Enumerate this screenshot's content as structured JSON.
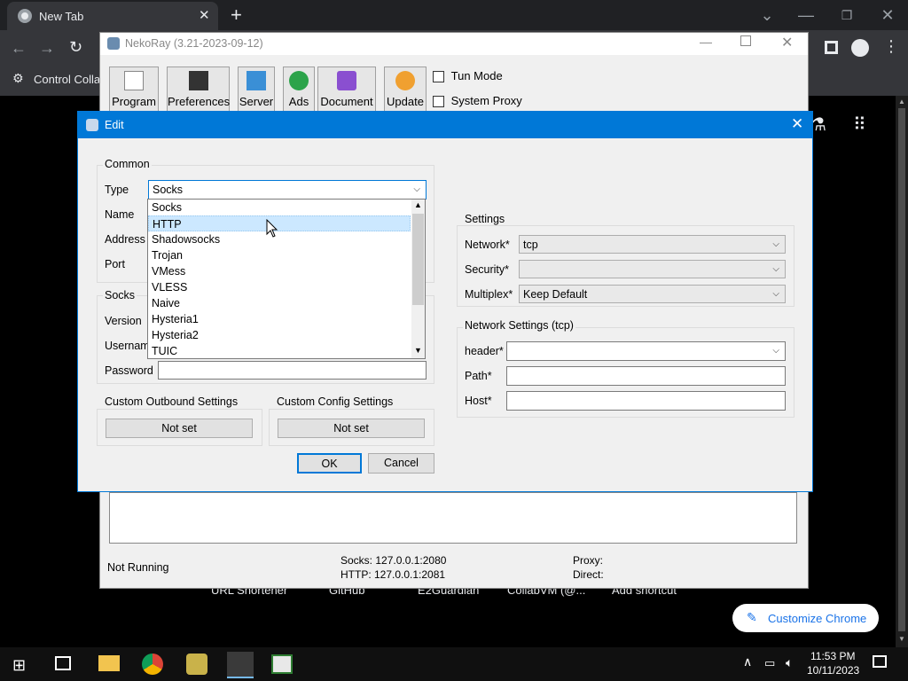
{
  "chrome": {
    "tab_title": "New Tab",
    "bookmark": "Control Collab",
    "shortcuts": [
      "URL Shortener",
      "GitHub",
      "E2Guardian",
      "CollabVM (@...",
      "Add shortcut"
    ],
    "customize_label": "Customize Chrome"
  },
  "neko": {
    "title": "NekoRay (3.21-2023-09-12)",
    "toolbar": [
      {
        "label": "Program",
        "icon": "terminal-icon"
      },
      {
        "label": "Preferences",
        "icon": "sliders-icon"
      },
      {
        "label": "Server",
        "icon": "folder-icon"
      },
      {
        "label": "Ads",
        "icon": "globe-icon"
      },
      {
        "label": "Document",
        "icon": "help-icon"
      },
      {
        "label": "Update",
        "icon": "upload-icon"
      }
    ],
    "tun_mode": "Tun Mode",
    "system_proxy": "System Proxy",
    "status": {
      "running": "Not Running",
      "socks": "Socks: 127.0.0.1:2080",
      "http": "HTTP: 127.0.0.1:2081",
      "proxy": "Proxy:",
      "direct": "Direct:"
    }
  },
  "edit": {
    "title": "Edit",
    "common": {
      "title": "Common",
      "type_label": "Type",
      "type_value": "Socks",
      "name_label": "Name",
      "address_label": "Address",
      "port_label": "Port"
    },
    "socks": {
      "title": "Socks",
      "version_label": "Version",
      "username_label": "Usernam",
      "password_label": "Password"
    },
    "dropdown_items": [
      "Socks",
      "HTTP",
      "Shadowsocks",
      "Trojan",
      "VMess",
      "VLESS",
      "Naive",
      "Hysteria1",
      "Hysteria2",
      "TUIC"
    ],
    "settings": {
      "title": "Settings",
      "network_label": "Network*",
      "network_value": "tcp",
      "security_label": "Security*",
      "security_value": "",
      "multiplex_label": "Multiplex*",
      "multiplex_value": "Keep Default"
    },
    "network_settings": {
      "title": "Network Settings (tcp)",
      "header_label": "header*",
      "path_label": "Path*",
      "host_label": "Host*"
    },
    "custom_outbound": {
      "title": "Custom Outbound Settings",
      "button": "Not set"
    },
    "custom_config": {
      "title": "Custom Config Settings",
      "button": "Not set"
    },
    "ok": "OK",
    "cancel": "Cancel"
  },
  "taskbar": {
    "time": "11:53 PM",
    "date": "10/11/2023"
  }
}
